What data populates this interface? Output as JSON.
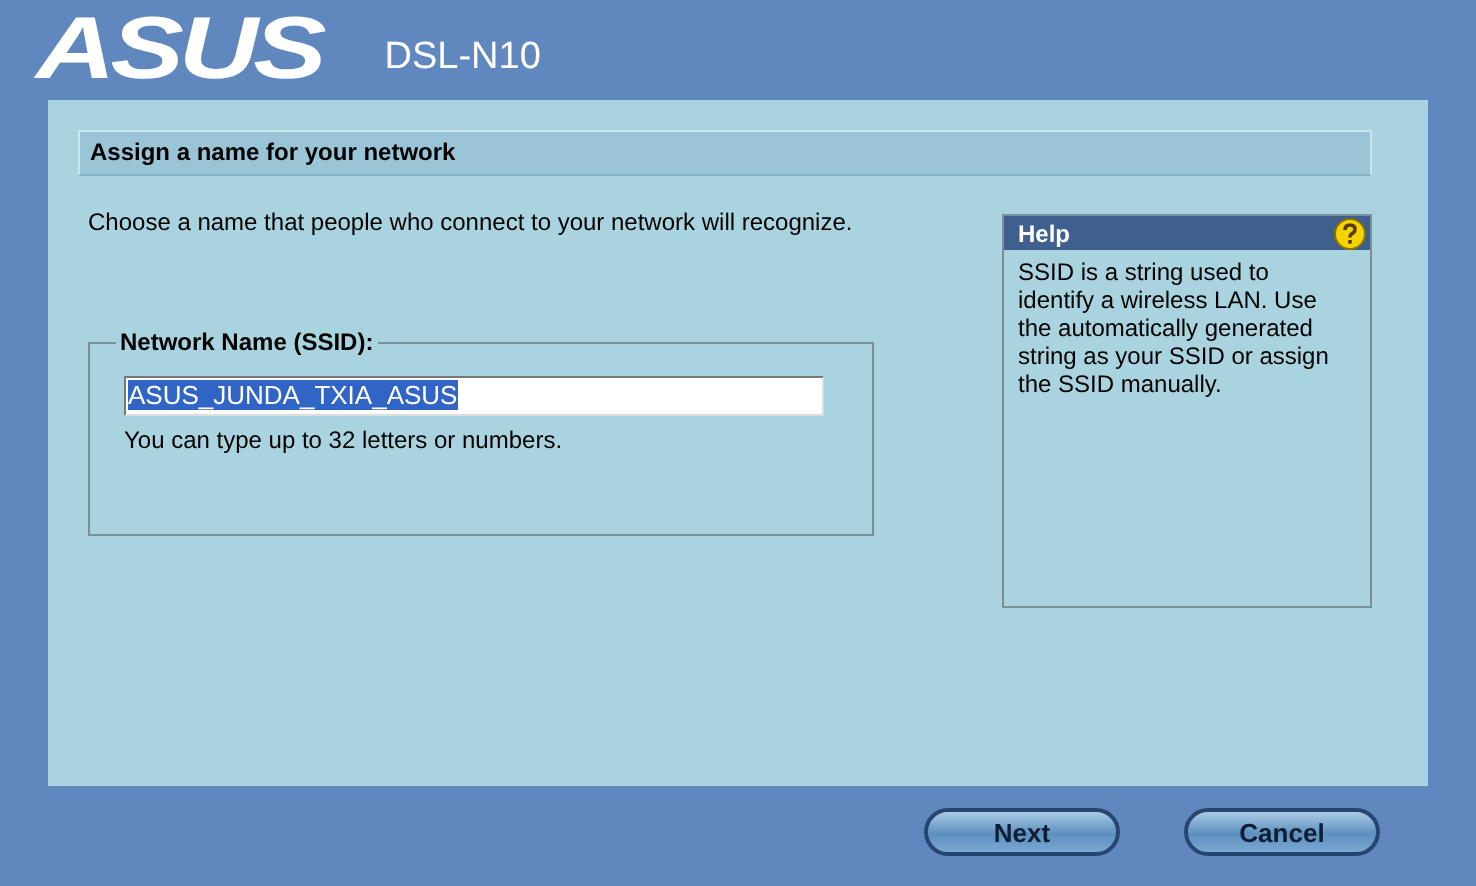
{
  "header": {
    "logo": "ASUS",
    "model": "DSL-N10"
  },
  "section_title": "Assign a name for your network",
  "intro": "Choose a name that people who connect to your network will recognize.",
  "ssid_group": {
    "legend": "Network Name (SSID):",
    "field": {
      "value": "ASUS_JUNDA_TXIA_ASUS",
      "text_selected": true
    },
    "hint": "You can type up to 32 letters or numbers."
  },
  "help": {
    "title": "Help",
    "text": "SSID is a string used to identify a wireless LAN. Use the automatically generated string as your SSID or assign the SSID manually."
  },
  "buttons": [
    "Next",
    "Cancel"
  ]
}
